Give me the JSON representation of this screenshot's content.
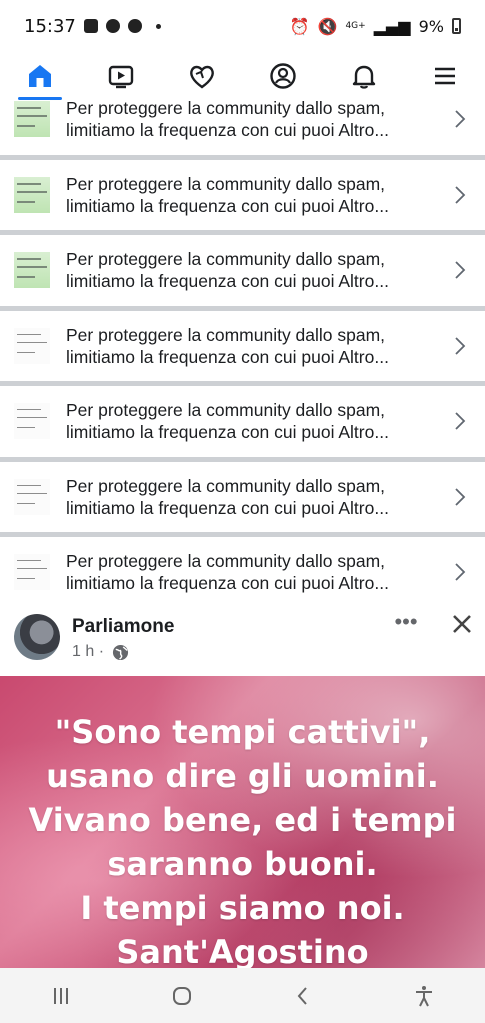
{
  "status_bar": {
    "time": "15:37",
    "network": "4G+",
    "battery": "9%"
  },
  "nav": {
    "items": [
      {
        "name": "home",
        "active": true
      },
      {
        "name": "watch",
        "active": false
      },
      {
        "name": "dating",
        "active": false
      },
      {
        "name": "profile",
        "active": false
      },
      {
        "name": "notifications",
        "active": false
      },
      {
        "name": "menu",
        "active": false
      }
    ],
    "accent_color": "#1877f2"
  },
  "notifications": [
    {
      "line1": "Per proteggere la community dallo spam,",
      "line2": "limitiamo la frequenza con cui puoi Altro...",
      "thumb": "green"
    },
    {
      "line1": "Per proteggere la community dallo spam,",
      "line2": "limitiamo la frequenza con cui puoi Altro...",
      "thumb": "green"
    },
    {
      "line1": "Per proteggere la community dallo spam,",
      "line2": "limitiamo la frequenza con cui puoi Altro...",
      "thumb": "green"
    },
    {
      "line1": "Per proteggere la community dallo spam,",
      "line2": "limitiamo la frequenza con cui puoi Altro...",
      "thumb": "plain"
    },
    {
      "line1": "Per proteggere la community dallo spam,",
      "line2": "limitiamo la frequenza con cui puoi Altro...",
      "thumb": "plain"
    },
    {
      "line1": "Per proteggere la community dallo spam,",
      "line2": "limitiamo la frequenza con cui puoi Altro...",
      "thumb": "plain"
    },
    {
      "line1": "Per proteggere la community dallo spam,",
      "line2": "limitiamo la frequenza con cui puoi Altro...",
      "thumb": "plain"
    }
  ],
  "post": {
    "author": "Parliamone",
    "time": "1 h ·",
    "more_label": "•••",
    "quote_lines": [
      "\"Sono tempi cattivi\",",
      "usano dire gli uomini.",
      "Vivano bene, ed i tempi",
      "saranno buoni.",
      "I tempi siamo noi.",
      "Sant'Agostino"
    ]
  }
}
